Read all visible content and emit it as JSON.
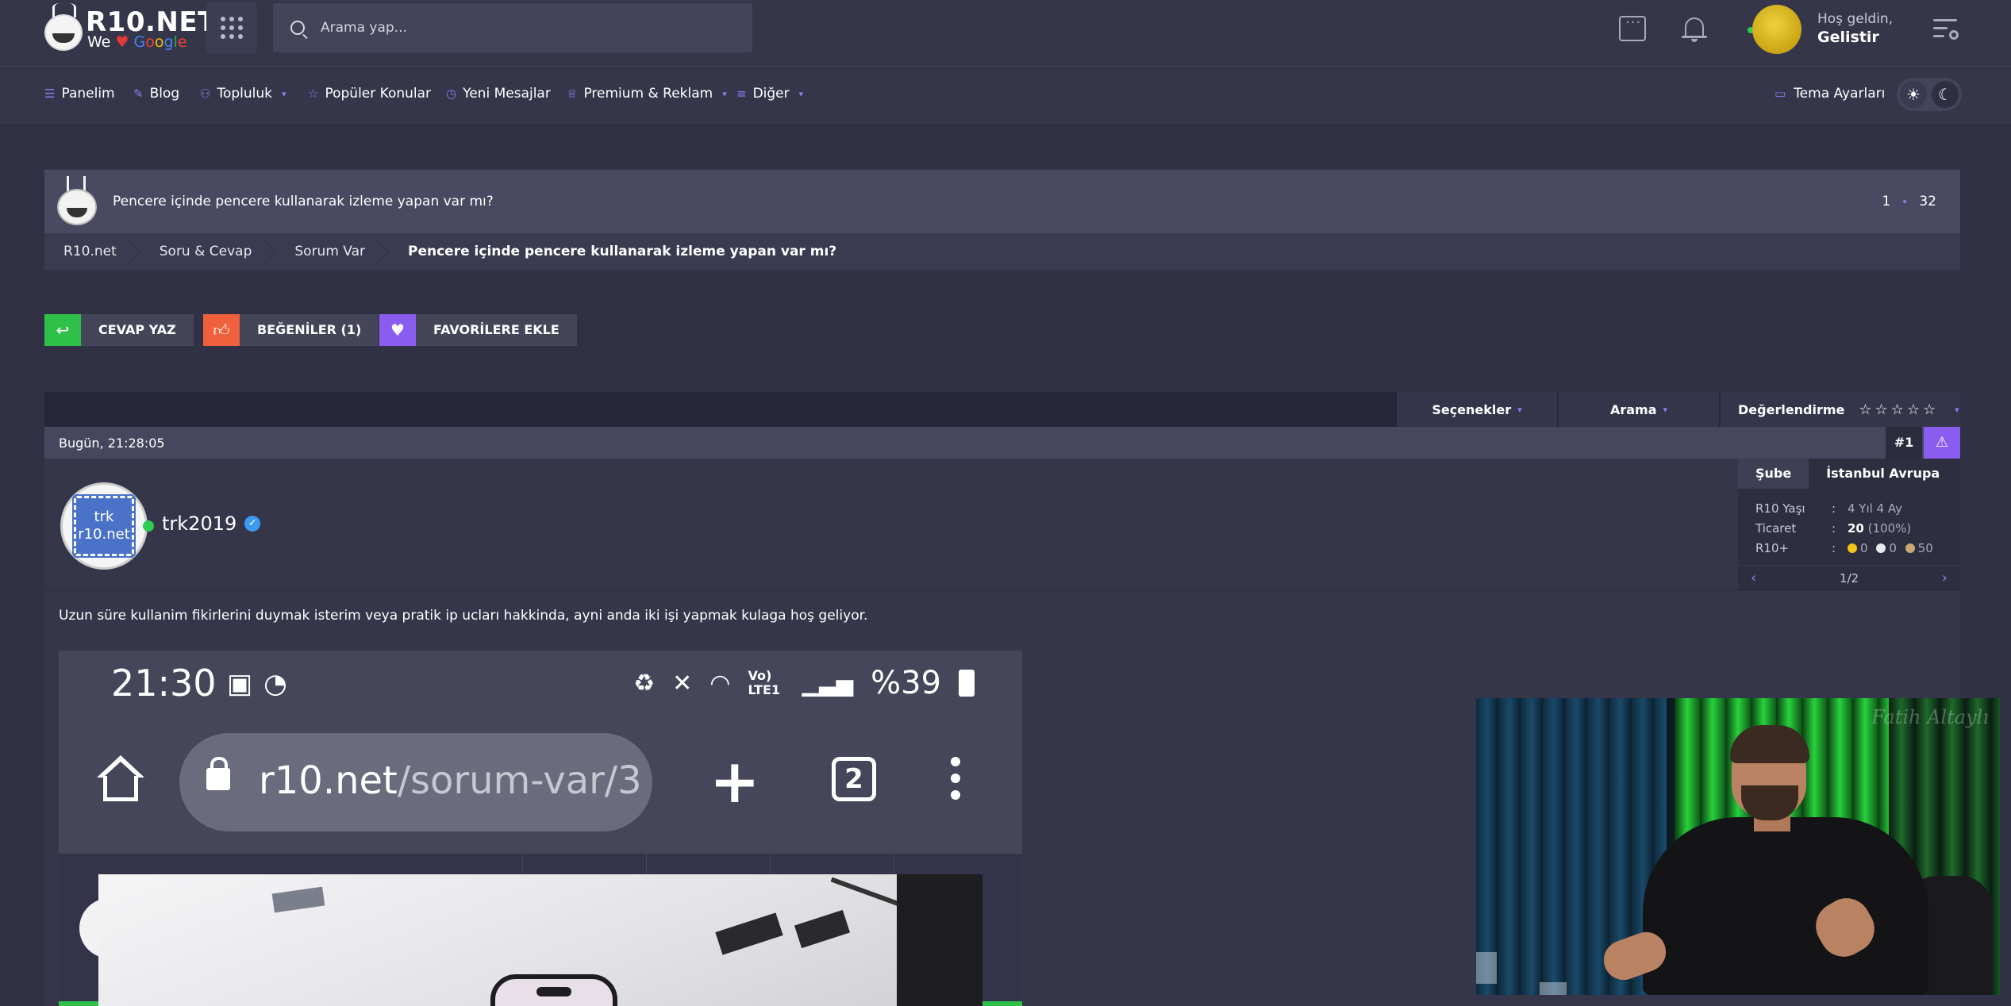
{
  "header": {
    "logo": {
      "title": "R10.NET",
      "we": "We",
      "heart": "♥",
      "google": [
        "G",
        "o",
        "o",
        "g",
        "l",
        "e"
      ]
    },
    "search_placeholder": "Arama yap...",
    "welcome": "Hoş geldin,",
    "username": "Gelistir"
  },
  "nav": {
    "items": [
      {
        "label": "Panelim",
        "icon": "sliders-icon"
      },
      {
        "label": "Blog",
        "icon": "feather-icon"
      },
      {
        "label": "Topluluk",
        "icon": "users-icon",
        "dropdown": true
      },
      {
        "label": "Popüler Konular",
        "icon": "star-icon"
      },
      {
        "label": "Yeni Mesajlar",
        "icon": "clock-icon"
      },
      {
        "label": "Premium & Reklam",
        "icon": "trophy-icon",
        "dropdown": true
      },
      {
        "label": "Diğer",
        "icon": "list-icon",
        "dropdown": true
      }
    ],
    "theme_settings": "Tema Ayarları"
  },
  "thread": {
    "title": "Pencere içinde pencere kullanarak izleme yapan var mı?",
    "page_current": "1",
    "page_total": "32"
  },
  "breadcrumb": [
    "R10.net",
    "Soru & Cevap",
    "Sorum Var",
    "Pencere içinde pencere kullanarak izleme yapan var mı?"
  ],
  "actions": {
    "reply": "CEVAP YAZ",
    "likes": "BEĞENİLER (1)",
    "favorite": "FAVORİLERE EKLE"
  },
  "toolbar": {
    "options": "Seçenekler",
    "search": "Arama",
    "rating": "Değerlendirme",
    "stars": "☆☆☆☆☆"
  },
  "post": {
    "date": "Bugün, 21:28:05",
    "number": "#1",
    "author": "trk2019",
    "avatar_text_1": "trk",
    "avatar_text_2": "r10.net",
    "text": "Uzun süre kullanim fikirlerini duymak isterim veya pratik ip ucları hakkinda, ayni anda iki işi yapmak kulaga hoş geliyor.",
    "user_panel": {
      "tab_active": "Şube",
      "tab_other": "İstanbul Avrupa",
      "rows": [
        {
          "key": "R10 Yaşı",
          "value": "4 Yıl 4 Ay"
        },
        {
          "key": "Ticaret",
          "value_bold": "20",
          "value": "(100%)"
        },
        {
          "key": "R10+",
          "c1": "0",
          "c2": "0",
          "c3": "50"
        }
      ],
      "pager": "1/2"
    }
  },
  "screenshot": {
    "time": "21:30",
    "battery": "%39",
    "network": "Vo) LTE1",
    "url_host": "r10.net",
    "url_path": "/sorum-var/3",
    "tabs_count": "2"
  },
  "video": {
    "watermark": "Fatih Altaylı"
  },
  "colors": {
    "accent": "#8b5cf0",
    "reply": "#2fc04a",
    "likes": "#f0603c",
    "online": "#2ecc52"
  }
}
